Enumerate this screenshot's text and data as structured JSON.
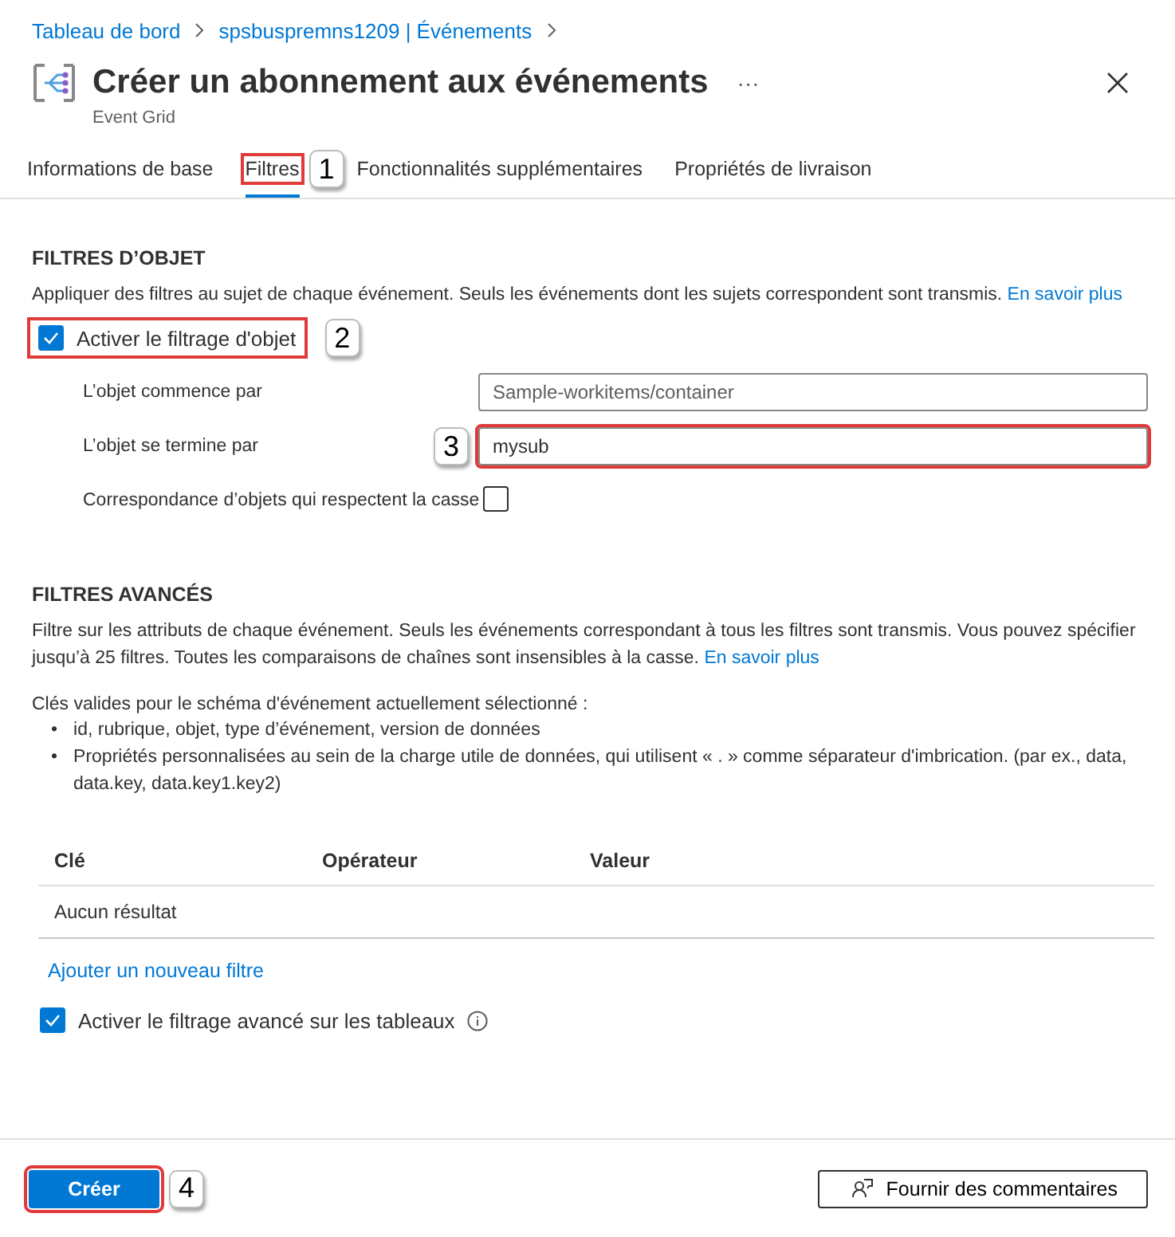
{
  "breadcrumb": [
    "Tableau de bord",
    "spsbuspremns1209 | Événements"
  ],
  "header": {
    "title": "Créer un abonnement aux événements",
    "more": "···",
    "subtitle": "Event Grid"
  },
  "tabs": [
    {
      "label": "Informations de base",
      "selected": false
    },
    {
      "label": "Filtres",
      "selected": true,
      "callout": "1"
    },
    {
      "label": "Fonctionnalités supplémentaires",
      "selected": false
    },
    {
      "label": "Propriétés de livraison",
      "selected": false
    }
  ],
  "subject_filters": {
    "heading": "FILTRES D’OBJET",
    "description": "Appliquer des filtres au sujet de chaque événement. Seuls les événements dont les sujets correspondent sont transmis.",
    "link": "En savoir plus",
    "enable": {
      "label": "Activer le filtrage d'objet",
      "checked": true,
      "callout": "2"
    },
    "fields": [
      {
        "label": "L’objet commence par",
        "kind": "text",
        "placeholder": "Sample-workitems/container"
      },
      {
        "label": "L’objet se termine par",
        "kind": "text",
        "value": "mysub",
        "callout": "3"
      },
      {
        "label": "Correspondance d’objets qui respectent la casse",
        "kind": "checkbox",
        "checked": false
      }
    ]
  },
  "advanced_filters": {
    "heading": "FILTRES AVANCÉS",
    "description": "Filtre sur les attributs de chaque événement. Seuls les événements correspondant à tous les filtres sont transmis. Vous pouvez spécifier jusqu’à 25 filtres. Toutes les comparaisons de chaînes sont insensibles à la casse.",
    "link": "En savoir plus",
    "keys_intro": "Clés valides pour le schéma d'événement actuellement sélectionné :",
    "keys": [
      {
        "bullet": "•",
        "text": "id, rubrique, objet, type d’événement, version de données"
      },
      {
        "bullet": "•",
        "text": "Propriétés personnalisées au sein de la charge utile de données, qui utilisent « . » comme séparateur d'imbrication. (par ex., data, data.key, data.key1.key2)"
      }
    ],
    "table": {
      "columns": [
        "Clé",
        "Opérateur",
        "Valeur"
      ],
      "empty": "Aucun résultat"
    },
    "add_link": "Ajouter un nouveau filtre",
    "arrays": {
      "label": "Activer le filtrage avancé sur les tableaux",
      "checked": true
    }
  },
  "footer": {
    "create": {
      "label": "Créer",
      "callout": "4"
    },
    "feedback": "Fournir des commentaires"
  }
}
